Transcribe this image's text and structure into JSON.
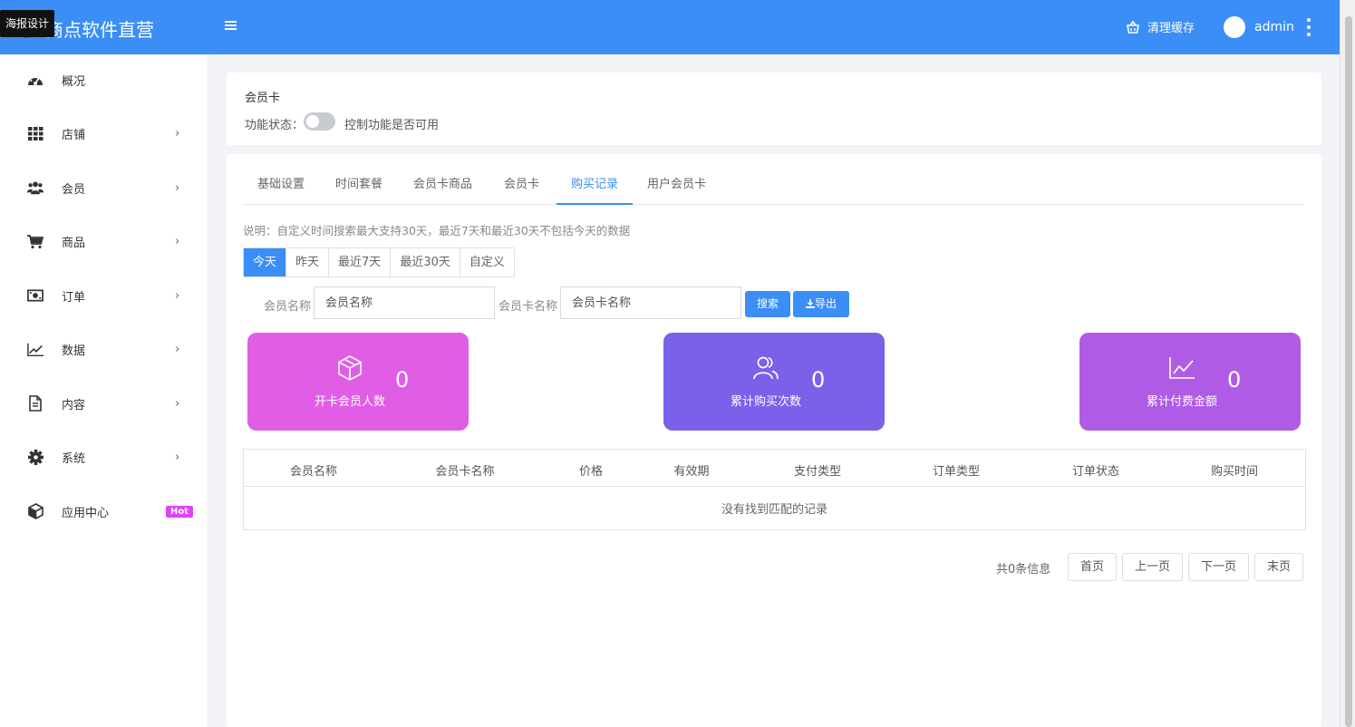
{
  "app": {
    "title": "商点软件直营",
    "tooltip": "海报设计"
  },
  "header": {
    "menu_icon": "hamburger-icon",
    "clear_cache": "清理缓存",
    "user": "admin"
  },
  "sidebar": {
    "items": [
      {
        "label": "概况",
        "icon": "dashboard-icon",
        "has_children": false
      },
      {
        "label": "店铺",
        "icon": "grid-icon",
        "has_children": true
      },
      {
        "label": "会员",
        "icon": "users-icon",
        "has_children": true
      },
      {
        "label": "商品",
        "icon": "cart-icon",
        "has_children": true
      },
      {
        "label": "订单",
        "icon": "money-icon",
        "has_children": true
      },
      {
        "label": "数据",
        "icon": "line-chart-icon",
        "has_children": true
      },
      {
        "label": "内容",
        "icon": "document-icon",
        "has_children": true
      },
      {
        "label": "系统",
        "icon": "gear-icon",
        "has_children": true
      },
      {
        "label": "应用中心",
        "icon": "cube-icon",
        "has_children": false,
        "badge": "Hot"
      }
    ],
    "chevron": "›"
  },
  "feature": {
    "title": "会员卡",
    "status_label": "功能状态：",
    "enabled": false,
    "description": "控制功能是否可用"
  },
  "tabs": [
    "基础设置",
    "时间套餐",
    "会员卡商品",
    "会员卡",
    "购买记录",
    "用户会员卡"
  ],
  "active_tab": "购买记录",
  "note": "说明：自定义时间搜索最大支持30天，最近7天和最近30天不包括今天的数据",
  "date_filters": [
    "今天",
    "昨天",
    "最近7天",
    "最近30天",
    "自定义"
  ],
  "active_date": "今天",
  "search": {
    "member_label": "会员名称",
    "member_placeholder": "会员名称",
    "card_label": "会员卡名称",
    "card_placeholder": "会员卡名称",
    "search_button": "搜索",
    "export_button": "导出"
  },
  "stats": [
    {
      "label": "开卡会员人数",
      "value": "0",
      "color": "#e05ee6",
      "icon": "box-icon"
    },
    {
      "label": "累计购买次数",
      "value": "0",
      "color": "#7b61ea",
      "icon": "users-outline-icon"
    },
    {
      "label": "累计付费金额",
      "value": "0",
      "color": "#b05be6",
      "icon": "line-chart-icon"
    }
  ],
  "table": {
    "columns": [
      "会员名称",
      "会员卡名称",
      "价格",
      "有效期",
      "支付类型",
      "订单类型",
      "订单状态",
      "购买时间"
    ],
    "empty_text": "没有找到匹配的记录"
  },
  "pagination": {
    "total": "共0条信息",
    "first": "首页",
    "prev": "上一页",
    "next": "下一页",
    "last": "末页"
  },
  "colors": {
    "primary": "#3a8ef6",
    "hot": "#e040fb"
  }
}
